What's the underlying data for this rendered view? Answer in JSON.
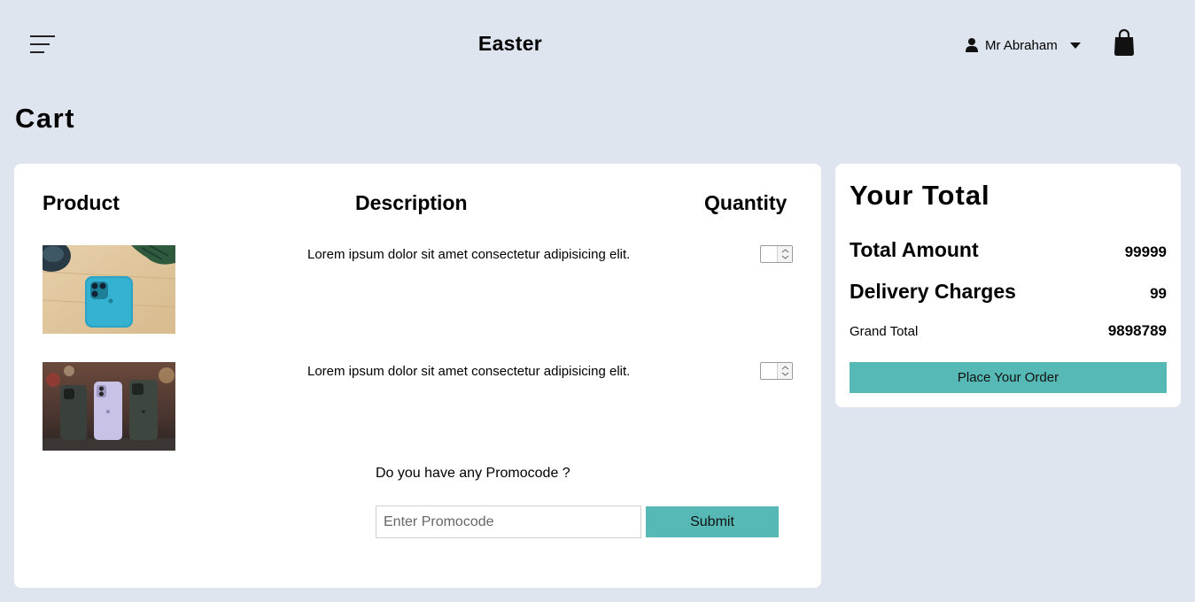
{
  "header": {
    "brand": "Easter",
    "user_name": "Mr Abraham"
  },
  "page": {
    "title": "Cart"
  },
  "cart": {
    "columns": {
      "product": "Product",
      "description": "Description",
      "quantity": "Quantity"
    },
    "items": [
      {
        "description": "Lorem ipsum dolor sit amet consectetur adipisicing elit.",
        "quantity": ""
      },
      {
        "description": "Lorem ipsum dolor sit amet consectetur adipisicing elit.",
        "quantity": ""
      }
    ],
    "promo": {
      "question": "Do you have any Promocode ?",
      "placeholder": "Enter Promocode",
      "submit_label": "Submit"
    }
  },
  "summary": {
    "title": "Your Total",
    "total_amount_label": "Total Amount",
    "total_amount_value": "99999",
    "delivery_label": "Delivery Charges",
    "delivery_value": "99",
    "grand_total_label": "Grand Total",
    "grand_total_value": "9898789",
    "order_button": "Place Your Order"
  },
  "colors": {
    "background": "#dfe5ee",
    "accent": "#56b9b5",
    "card": "#ffffff"
  }
}
